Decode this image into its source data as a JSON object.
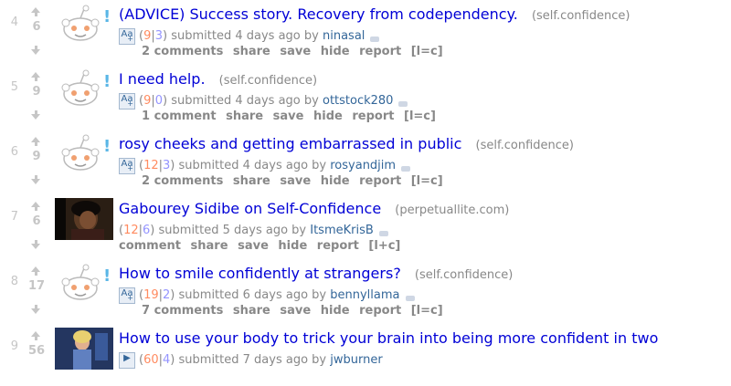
{
  "posts": [
    {
      "rank": "4",
      "score": "6",
      "title": "(ADVICE) Success story. Recovery from codependency.",
      "domain": "(self.confidence)",
      "up": "9",
      "down": "3",
      "time": "submitted 4 days ago by",
      "author": "ninasal",
      "comments": "2 comments",
      "expando": "Aa",
      "thumb": "reddit-alien-icon"
    },
    {
      "rank": "5",
      "score": "9",
      "title": "I need help.",
      "domain": "(self.confidence)",
      "up": "9",
      "down": "0",
      "time": "submitted 4 days ago by",
      "author": "ottstock280",
      "comments": "1 comment",
      "expando": "Aa",
      "thumb": "reddit-alien-icon"
    },
    {
      "rank": "6",
      "score": "9",
      "title": "rosy cheeks and getting embarrassed in public",
      "domain": "(self.confidence)",
      "up": "12",
      "down": "3",
      "time": "submitted 4 days ago by",
      "author": "rosyandjim",
      "comments": "2 comments",
      "expando": "Aa",
      "thumb": "reddit-alien-icon"
    },
    {
      "rank": "7",
      "score": "6",
      "title": "Gabourey Sidibe on Self-Confidence",
      "domain": "(perpetuallite.com)",
      "up": "12",
      "down": "6",
      "time": "submitted 5 days ago by",
      "author": "ItsmeKrisB",
      "comments": "comment",
      "expando": "",
      "thumb": "photo"
    },
    {
      "rank": "8",
      "score": "17",
      "title": "How to smile confidently at strangers?",
      "domain": "(self.confidence)",
      "up": "19",
      "down": "2",
      "time": "submitted 6 days ago by",
      "author": "bennyllama",
      "comments": "7 comments",
      "expando": "Aa",
      "thumb": "reddit-alien-icon"
    },
    {
      "rank": "9",
      "score": "56",
      "title": "How to use your body to trick your brain into being more confident in two",
      "domain": "",
      "up": "60",
      "down": "4",
      "time": "submitted 7 days ago by",
      "author": "jwburner",
      "comments": "",
      "expando": "▶",
      "thumb": "photo"
    }
  ],
  "buttons": {
    "share": "share",
    "save": "save",
    "hide": "hide",
    "report": "report",
    "lc_self": "[l=c]",
    "lc_link": "[l+c]"
  },
  "colors": {
    "title": "#0000d6",
    "upvote": "#ff8b60",
    "downvote": "#9494ff",
    "author": "#336699",
    "muted": "#888888"
  }
}
